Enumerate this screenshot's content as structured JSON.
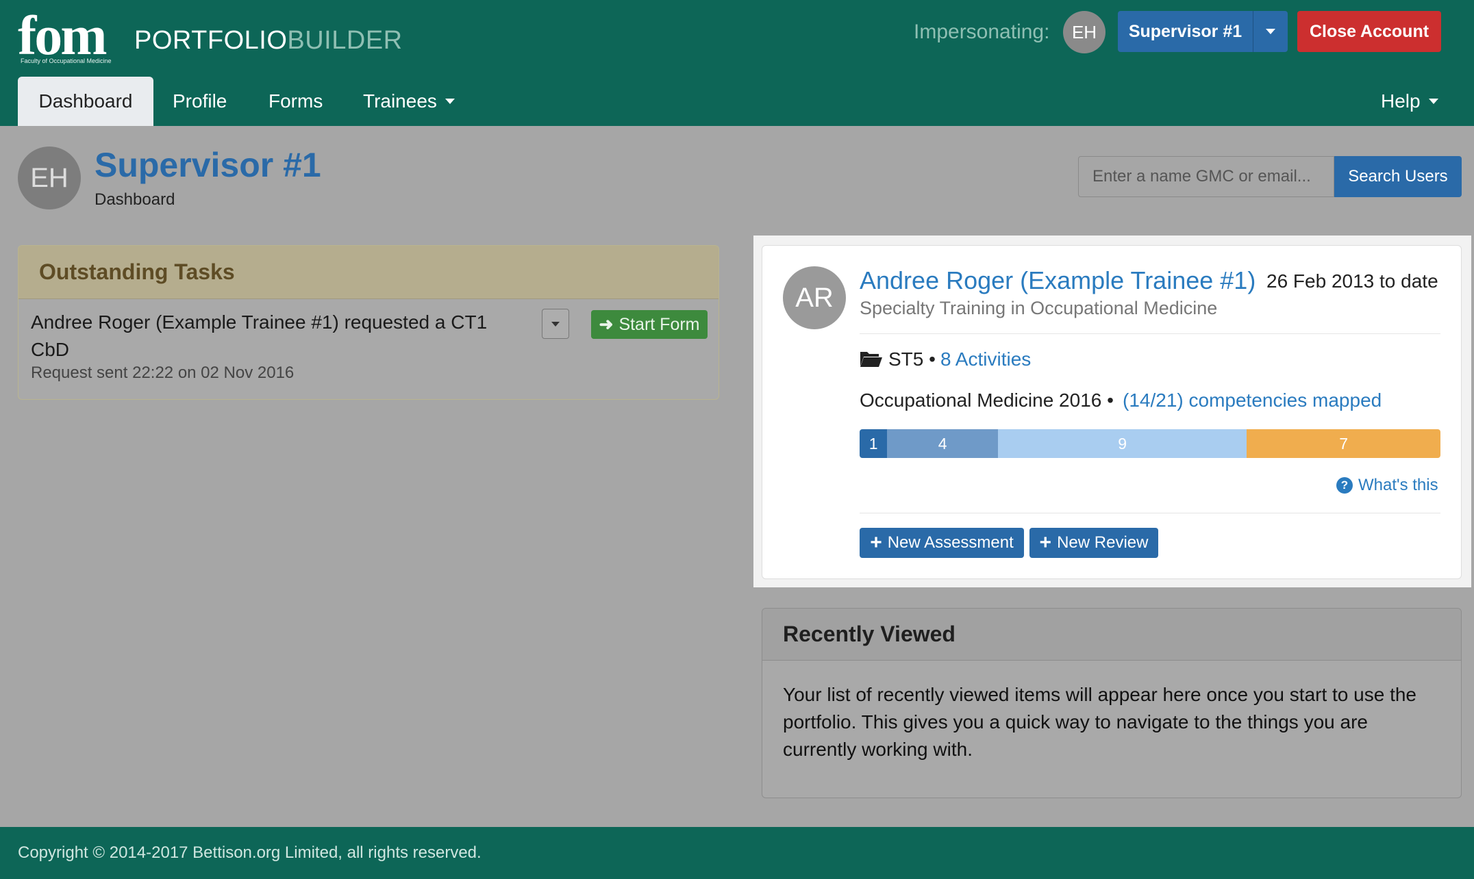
{
  "header": {
    "logo_text": "fom",
    "logo_subtext": "Faculty of Occupational Medicine",
    "brand_part1": "PORTFOLIO",
    "brand_part2": "BUILDER",
    "impersonating_label": "Impersonating:",
    "impersonating_initials": "EH",
    "user_button_label": "Supervisor #1",
    "close_account_label": "Close Account"
  },
  "nav": {
    "items": [
      {
        "label": "Dashboard",
        "active": true
      },
      {
        "label": "Profile"
      },
      {
        "label": "Forms"
      },
      {
        "label": "Trainees",
        "has_dropdown": true
      }
    ],
    "help_label": "Help"
  },
  "page": {
    "avatar_initials": "EH",
    "title": "Supervisor #1",
    "subtitle": "Dashboard",
    "search_placeholder": "Enter a name GMC or email...",
    "search_button_label": "Search Users"
  },
  "tasks": {
    "title": "Outstanding Tasks",
    "items": [
      {
        "text": "Andree Roger (Example Trainee #1) requested a CT1 CbD",
        "sent": "Request sent 22:22 on 02 Nov 2016",
        "action_label": "Start Form"
      }
    ]
  },
  "trainee": {
    "initials": "AR",
    "name": "Andree Roger (Example Trainee #1)",
    "dates": "26 Feb 2013 to date",
    "program": "Specialty Training in Occupational Medicine",
    "grade": "ST5",
    "separator": "•",
    "activities_label": "8 Activities",
    "curriculum": "Occupational Medicine 2016 •",
    "competencies_label": "(14/21) competencies mapped",
    "progress_segments": [
      {
        "value": 1,
        "label": "1",
        "color": "#2a6aa8"
      },
      {
        "value": 4,
        "label": "4",
        "color": "#6f9ac8"
      },
      {
        "value": 9,
        "label": "9",
        "color": "#a9cdf0"
      },
      {
        "value": 7,
        "label": "7",
        "color": "#f0ad4e"
      }
    ],
    "whats_this_label": "What's this",
    "new_assessment_label": "New Assessment",
    "new_review_label": "New Review"
  },
  "recent": {
    "title": "Recently Viewed",
    "body": "Your list of recently viewed items will appear here once you start to use the portfolio. This gives you a quick way to navigate to the things you are currently working with."
  },
  "footer": {
    "text": "Copyright © 2014-2017 Bettison.org Limited, all rights reserved."
  },
  "colors": {
    "header_bg": "#0d6657",
    "primary": "#2a6aa8",
    "danger": "#cc2f2f",
    "success": "#3d8a3d",
    "link": "#2a7bbf"
  }
}
